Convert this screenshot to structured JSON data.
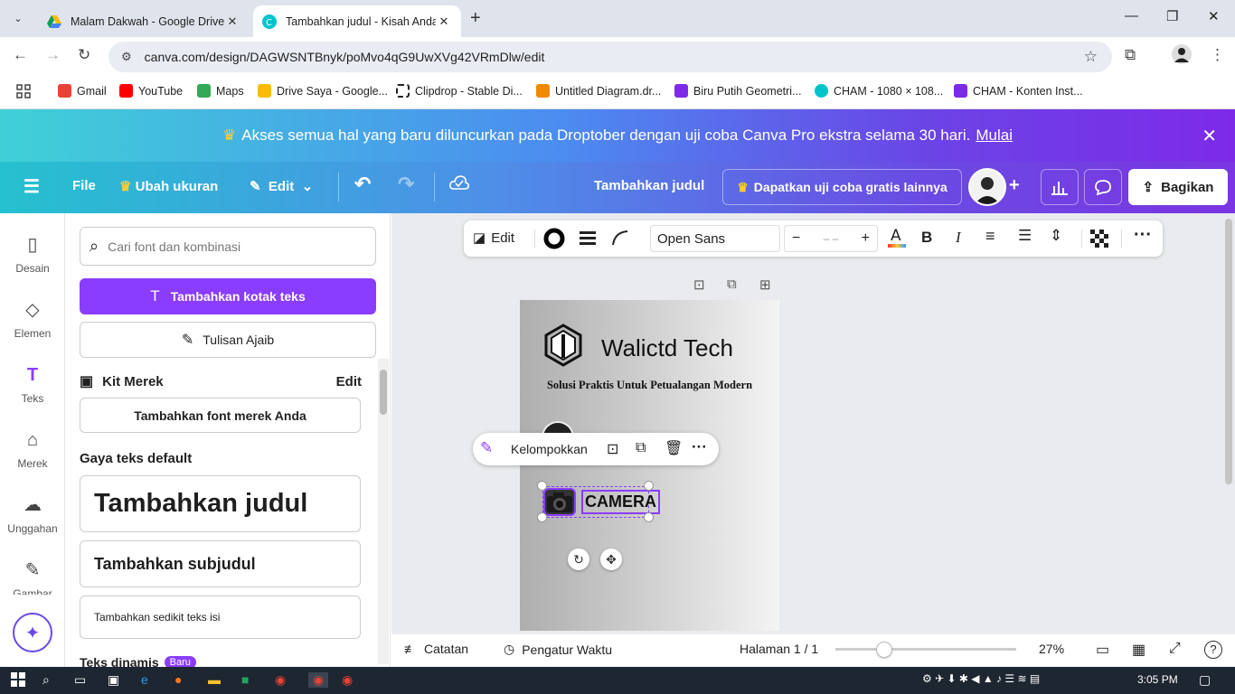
{
  "browser": {
    "tabs": [
      {
        "title": "Malam Dakwah - Google Drive",
        "active": false
      },
      {
        "title": "Tambahkan judul - Kisah Anda",
        "active": true
      }
    ],
    "url": "canva.com/design/DAGWSNTBnyk/poMvo4qG9UwXVg42VRmDlw/edit",
    "bookmarks": [
      {
        "label": "Gmail",
        "color": "#ea4335"
      },
      {
        "label": "YouTube",
        "color": "#ff0000"
      },
      {
        "label": "Maps",
        "color": "#34a853"
      },
      {
        "label": "Drive Saya - Google...",
        "color": "#fbbc04"
      },
      {
        "label": "Clipdrop - Stable Di...",
        "color": "#222222"
      },
      {
        "label": "Untitled Diagram.dr...",
        "color": "#f08705"
      },
      {
        "label": "Biru Putih Geometri...",
        "color": "#7d2ae8"
      },
      {
        "label": "CHAM - 1080 × 108...",
        "color": "#00c4cc"
      },
      {
        "label": "CHAM - Konten Inst...",
        "color": "#7d2ae8"
      }
    ]
  },
  "promo": {
    "text": "Akses semua hal yang baru diluncurkan pada Droptober dengan uji coba Canva Pro ekstra selama 30 hari.",
    "link": "Mulai"
  },
  "header": {
    "file": "File",
    "resize": "Ubah ukuran",
    "edit": "Edit",
    "title": "Tambahkan judul",
    "trial": "Dapatkan uji coba gratis lainnya",
    "share": "Bagikan"
  },
  "rail": [
    {
      "label": "Desain",
      "icon": "layout-icon"
    },
    {
      "label": "Elemen",
      "icon": "shapes-icon"
    },
    {
      "label": "Teks",
      "icon": "text-icon"
    },
    {
      "label": "Merek",
      "icon": "brand-icon"
    },
    {
      "label": "Unggahan",
      "icon": "cloud-upload-icon"
    },
    {
      "label": "Gambar",
      "icon": "draw-icon"
    }
  ],
  "panel": {
    "search_placeholder": "Cari font dan kombinasi",
    "add_textbox": "Tambahkan kotak teks",
    "magic_write": "Tulisan Ajaib",
    "brand_kit": "Kit Merek",
    "brand_edit": "Edit",
    "add_brand_font": "Tambahkan font merek Anda",
    "default_styles": "Gaya teks default",
    "heading": "Tambahkan judul",
    "subheading": "Tambahkan subjudul",
    "body": "Tambahkan sedikit teks isi",
    "dynamic": "Teks dinamis",
    "new_badge": "Baru"
  },
  "toolbar": {
    "edit": "Edit",
    "font": "Open Sans",
    "size": "– –",
    "minus": "−",
    "plus": "+"
  },
  "design": {
    "brand": "Walictd Tech",
    "tagline": "Solusi Praktis Untuk Petualangan Modern",
    "item": "CAMERA"
  },
  "context_menu": {
    "group": "Kelompokkan"
  },
  "footer": {
    "notes": "Catatan",
    "timer": "Pengatur Waktu",
    "page": "Halaman 1 / 1",
    "zoom": "27%",
    "zoom_fraction": 0.27
  },
  "taskbar": {
    "time": "3:05 PM"
  },
  "colors": {
    "accent": "#8b3dff",
    "selection": "#8b3dff"
  }
}
